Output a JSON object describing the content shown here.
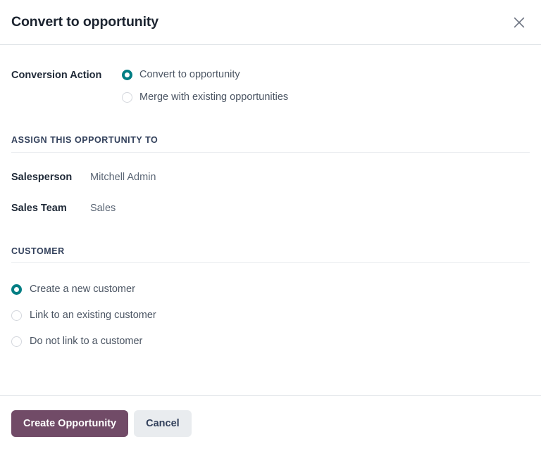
{
  "dialog": {
    "title": "Convert to opportunity",
    "close_icon": "close-icon"
  },
  "conversion": {
    "label": "Conversion Action",
    "options": [
      {
        "label": "Convert to opportunity",
        "selected": true
      },
      {
        "label": "Merge with existing opportunities",
        "selected": false
      }
    ]
  },
  "assign_section": {
    "title": "ASSIGN THIS OPPORTUNITY TO",
    "fields": [
      {
        "label": "Salesperson",
        "value": "Mitchell Admin"
      },
      {
        "label": "Sales Team",
        "value": "Sales"
      }
    ]
  },
  "customer_section": {
    "title": "CUSTOMER",
    "options": [
      {
        "label": "Create a new customer",
        "selected": true
      },
      {
        "label": "Link to an existing customer",
        "selected": false
      },
      {
        "label": "Do not link to a customer",
        "selected": false
      }
    ]
  },
  "footer": {
    "primary_label": "Create Opportunity",
    "secondary_label": "Cancel"
  },
  "colors": {
    "accent_radio": "#017e84",
    "primary_button": "#714b67",
    "secondary_button": "#e9ecef",
    "title_text": "#1c2430",
    "divider": "#e9ecef"
  }
}
